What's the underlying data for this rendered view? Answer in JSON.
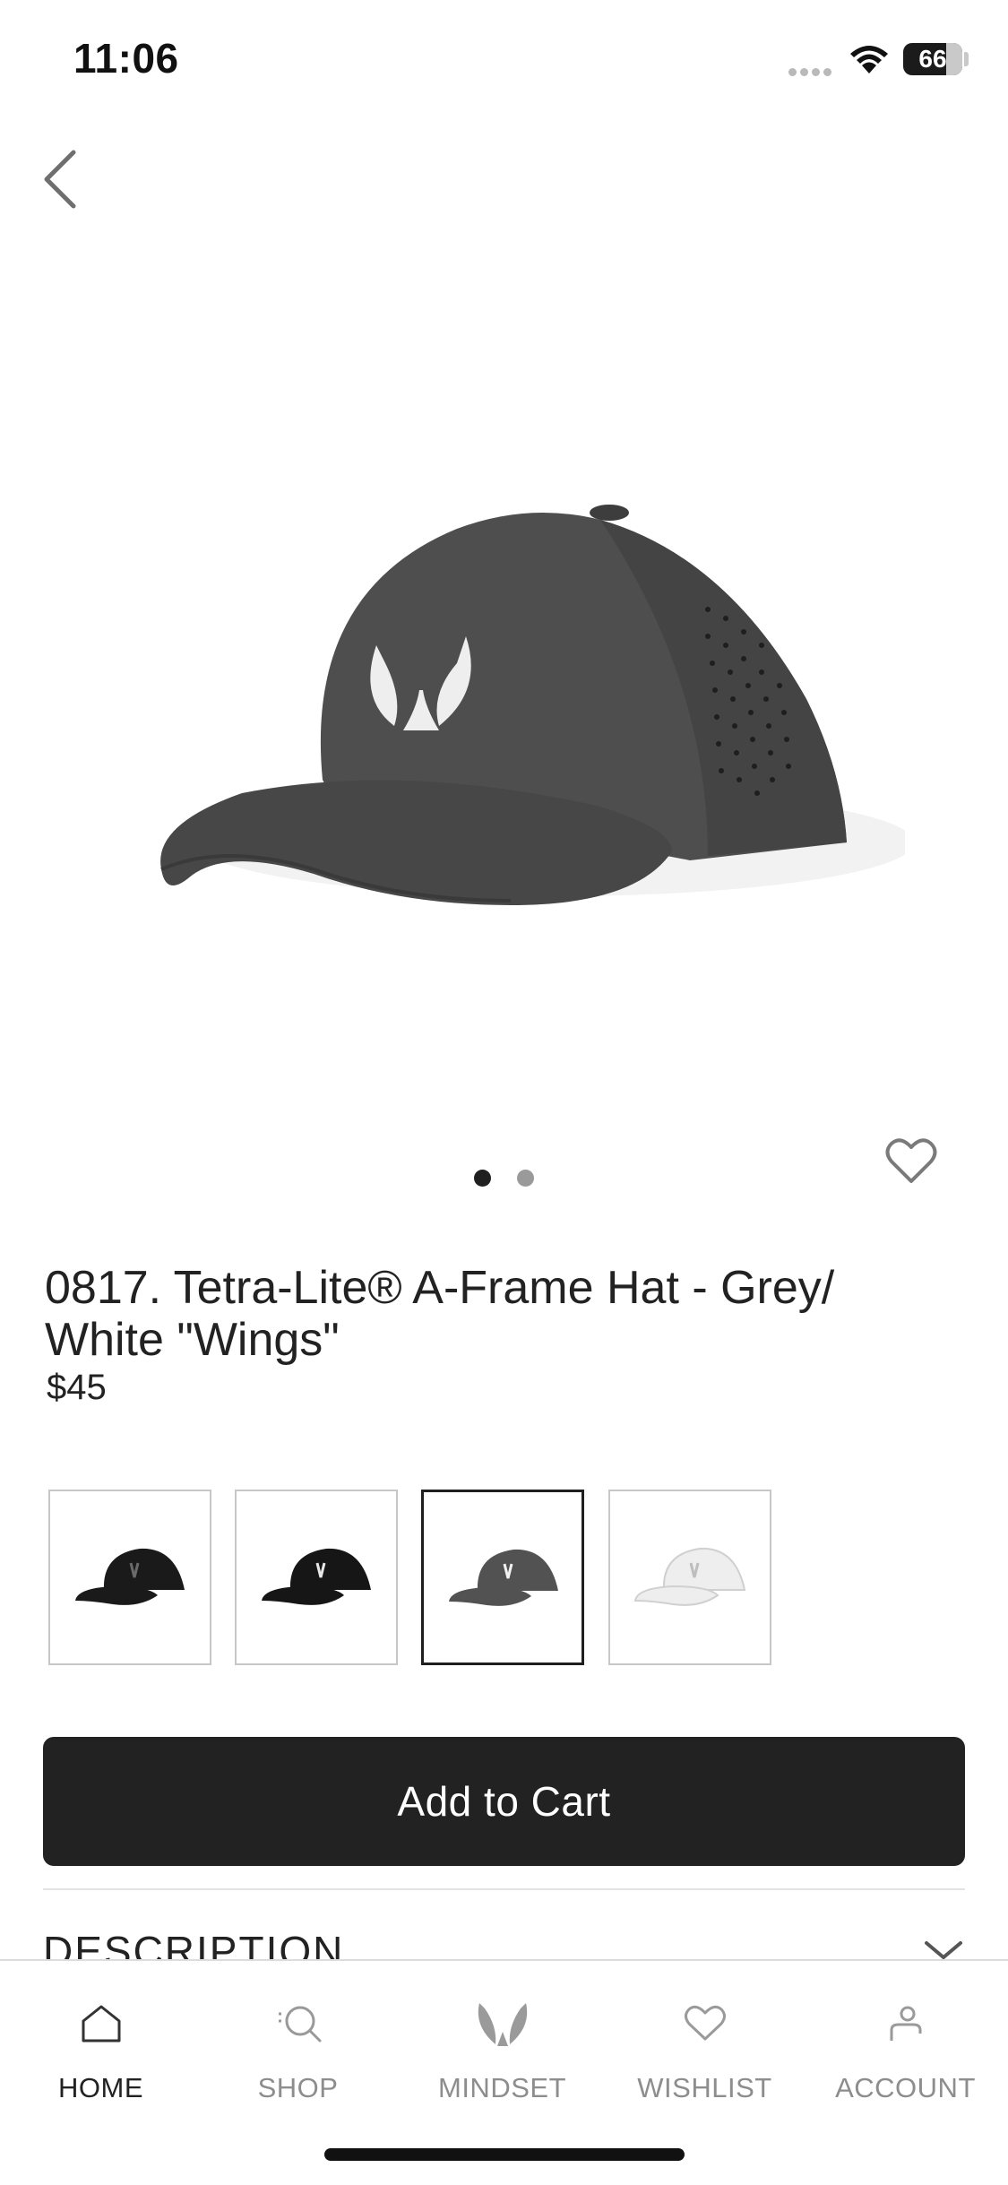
{
  "status_bar": {
    "time": "11:06",
    "battery": "66"
  },
  "product": {
    "title": "0817. Tetra-Lite® A-Frame Hat - Grey/ White \"Wings\"",
    "price": "$45",
    "image_pager": {
      "count": 2,
      "active_index": 0
    },
    "hero_color": "#4a4a4a",
    "swatches": [
      {
        "color": "#1a1a1a",
        "logo": "#6a6a6a",
        "selected": false
      },
      {
        "color": "#161616",
        "logo": "#e8e8e8",
        "selected": false
      },
      {
        "color": "#525252",
        "logo": "#f2f2f2",
        "selected": true
      },
      {
        "color": "#eeeeee",
        "logo": "#bdbdbd",
        "selected": false
      }
    ]
  },
  "actions": {
    "add_to_cart": "Add to Cart"
  },
  "sections": {
    "description": "DESCRIPTION"
  },
  "tabbar": {
    "items": [
      {
        "label": "HOME",
        "icon": "home-icon",
        "active": true
      },
      {
        "label": "SHOP",
        "icon": "search-icon",
        "active": false
      },
      {
        "label": "MINDSET",
        "icon": "wings-logo-icon",
        "active": false
      },
      {
        "label": "WISHLIST",
        "icon": "heart-icon",
        "active": false
      },
      {
        "label": "ACCOUNT",
        "icon": "person-icon",
        "active": false
      }
    ]
  },
  "icons": {
    "back": "chevron-left-icon",
    "favorite": "heart-icon",
    "expand": "chevron-down-icon"
  }
}
